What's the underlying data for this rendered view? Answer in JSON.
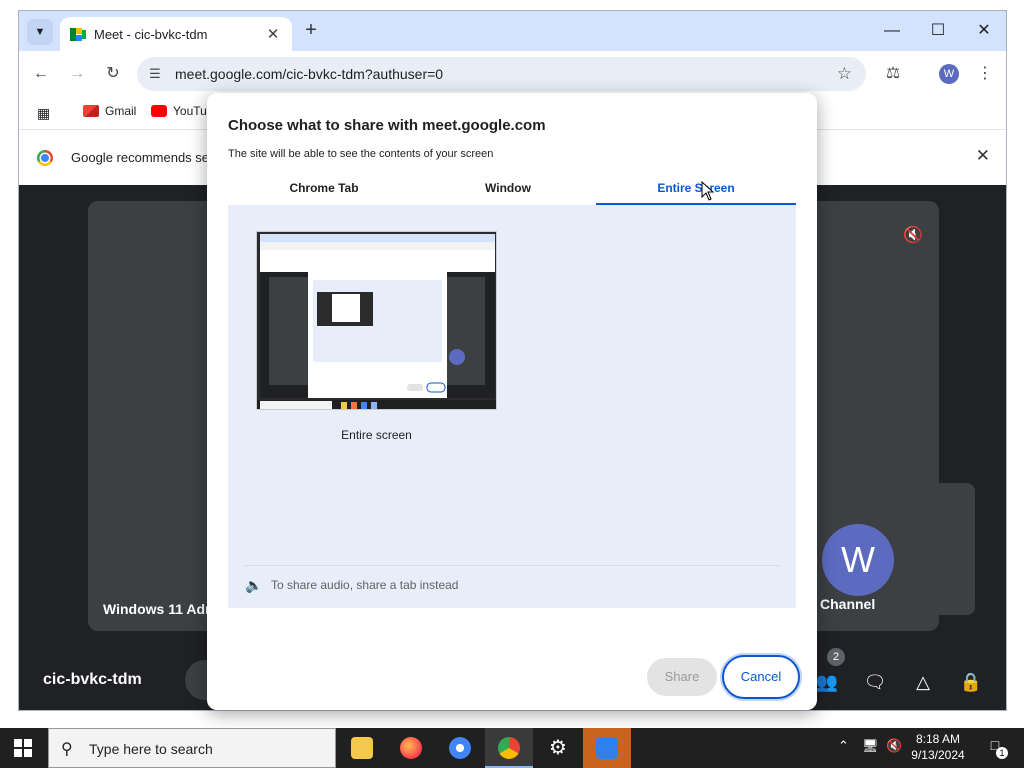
{
  "browser": {
    "tab_title": "Meet - cic-bvkc-tdm",
    "new_tab_label": "+",
    "url": "meet.google.com/cic-bvkc-tdm?authuser=0",
    "profile_initial": "W",
    "bookmarks": [
      {
        "label": "Gmail"
      },
      {
        "label": "YouTu"
      }
    ],
    "infobar_text": "Google recommends se"
  },
  "meet": {
    "main_tile_name": "Windows 11 Adm",
    "self_avatar_initial": "W",
    "self_name": "Channel",
    "meeting_code": "cic-bvkc-tdm",
    "people_count": "2"
  },
  "dialog": {
    "title": "Choose what to share with meet.google.com",
    "subtitle": "The site will be able to see the contents of your screen",
    "tabs": [
      {
        "label": "Chrome Tab",
        "active": false
      },
      {
        "label": "Window",
        "active": false
      },
      {
        "label": "Entire Screen",
        "active": true
      }
    ],
    "thumbnail_label": "Entire screen",
    "audio_hint": "To share audio, share a tab instead",
    "share_label": "Share",
    "cancel_label": "Cancel"
  },
  "taskbar": {
    "search_placeholder": "Type here to search",
    "time": "8:18 AM",
    "date": "9/13/2024",
    "notification_count": "1"
  },
  "colors": {
    "accent": "#0b57d0",
    "tabstrip": "#d3e3fd",
    "meet_bg": "#202124",
    "avatar": "#5c6bc0"
  }
}
